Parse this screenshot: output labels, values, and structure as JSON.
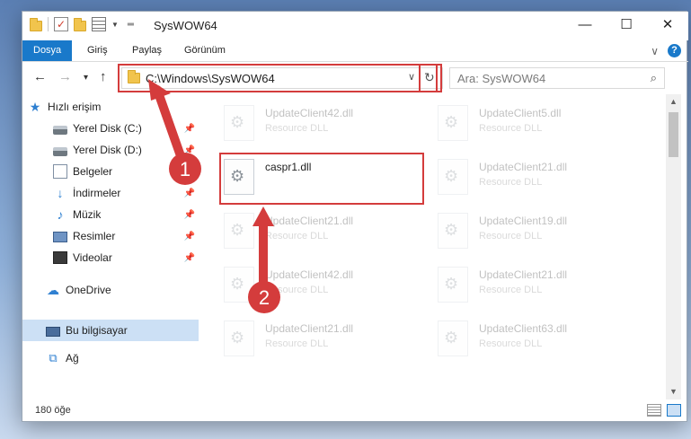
{
  "window": {
    "title": "SysWOW64",
    "minimize": "—",
    "maximize": "☐",
    "close": "✕"
  },
  "ribbon": {
    "tabs": [
      {
        "label": "Dosya",
        "active": true
      },
      {
        "label": "Giriş",
        "active": false
      },
      {
        "label": "Paylaş",
        "active": false
      },
      {
        "label": "Görünüm",
        "active": false
      }
    ],
    "help": "?"
  },
  "nav": {
    "back": "←",
    "forward": "→",
    "recent": "▾",
    "up": "↑",
    "address": "C:\\Windows\\SysWOW64",
    "address_dropdown": "∨",
    "refresh": "↻",
    "search_placeholder": "Ara: SysWOW64",
    "search_icon": "⌕"
  },
  "sidebar": {
    "items": [
      {
        "label": "Hızlı erişim",
        "icon": "star-icon",
        "glyph": "★",
        "pinned": false,
        "selected": false
      },
      {
        "label": "Yerel Disk (C:)",
        "icon": "drive-icon",
        "glyph": "",
        "pinned": true,
        "selected": false
      },
      {
        "label": "Yerel Disk (D:)",
        "icon": "drive-icon",
        "glyph": "",
        "pinned": true,
        "selected": false
      },
      {
        "label": "Belgeler",
        "icon": "documents-icon",
        "glyph": "",
        "pinned": true,
        "selected": false
      },
      {
        "label": "İndirmeler",
        "icon": "download-icon",
        "glyph": "↓",
        "pinned": true,
        "selected": false
      },
      {
        "label": "Müzik",
        "icon": "music-icon",
        "glyph": "♪",
        "pinned": true,
        "selected": false
      },
      {
        "label": "Resimler",
        "icon": "pictures-icon",
        "glyph": "",
        "pinned": true,
        "selected": false
      },
      {
        "label": "Videolar",
        "icon": "videos-icon",
        "glyph": "",
        "pinned": true,
        "selected": false
      },
      {
        "label": "OneDrive",
        "icon": "cloud-icon",
        "glyph": "☁",
        "pinned": false,
        "selected": false
      },
      {
        "label": "Bu bilgisayar",
        "icon": "computer-icon",
        "glyph": "",
        "pinned": false,
        "selected": true
      },
      {
        "label": "Ağ",
        "icon": "network-icon",
        "glyph": "⧉",
        "pinned": false,
        "selected": false
      }
    ],
    "pin_glyph": "📌"
  },
  "files": [
    {
      "name": "UpdateClient42.dll",
      "type": "Resource DLL",
      "faded": true
    },
    {
      "name": "UpdateClient5.dll",
      "type": "Resource DLL",
      "faded": true
    },
    {
      "name": "caspr1.dll",
      "type": "",
      "faded": false
    },
    {
      "name": "UpdateClient21.dll",
      "type": "Resource DLL",
      "faded": true
    },
    {
      "name": "UpdateClient21.dll",
      "type": "Resource DLL",
      "faded": true
    },
    {
      "name": "UpdateClient19.dll",
      "type": "Resource DLL",
      "faded": true
    },
    {
      "name": "UpdateClient42.dll",
      "type": "Resource DLL",
      "faded": true
    },
    {
      "name": "UpdateClient21.dll",
      "type": "Resource DLL",
      "faded": true
    },
    {
      "name": "UpdateClient21.dll",
      "type": "Resource DLL",
      "faded": true
    },
    {
      "name": "UpdateClient63.dll",
      "type": "Resource DLL",
      "faded": true
    }
  ],
  "status": {
    "count": "180 öğe"
  },
  "annotations": {
    "step1": "1",
    "step2": "2",
    "color": "#d43c3c"
  }
}
